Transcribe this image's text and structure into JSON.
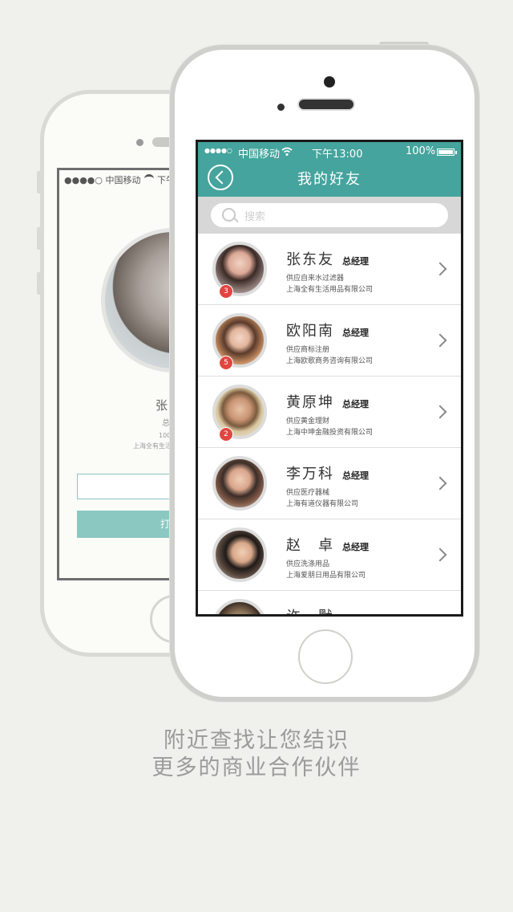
{
  "back_phone": {
    "carrier": "●●●●○ 中国移动",
    "time_partial": "下午",
    "name_partial": "张东",
    "title_partial": "总经",
    "count_partial": "100",
    "company_partial": "上海全有生活",
    "button_partial": "打"
  },
  "front_phone": {
    "status": {
      "signal": "●●●●○",
      "carrier": "中国移动",
      "time": "下午13:00",
      "battery": "100%"
    },
    "header": {
      "title": "我的好友"
    },
    "search": {
      "placeholder": "搜索"
    },
    "friends": [
      {
        "name": "张东友",
        "role": "总经理",
        "desc": "供应自来水过滤器",
        "company": "上海全有生活用品有限公司",
        "badge": "3"
      },
      {
        "name": "欧阳南",
        "role": "总经理",
        "desc": "供应商标注册",
        "company": "上海欧歌商务咨询有限公司",
        "badge": "5"
      },
      {
        "name": "黄原坤",
        "role": "总经理",
        "desc": "供应黄金理财",
        "company": "上海中坤金融投资有限公司",
        "badge": "2"
      },
      {
        "name": "李万科",
        "role": "总经理",
        "desc": "供应医疗器械",
        "company": "上海有道仪器有限公司",
        "badge": ""
      },
      {
        "name": "赵　卓",
        "role": "总经理",
        "desc": "供应洗涤用品",
        "company": "上海爱朋日用品有限公司",
        "badge": ""
      },
      {
        "name": "许　默",
        "role": "",
        "desc": "",
        "company": "",
        "badge": ""
      }
    ]
  },
  "caption": {
    "line1": "附近查找让您结识",
    "line2": "更多的商业合作伙伴"
  },
  "colors": {
    "accent": "#45a49d",
    "badge": "#e0463f",
    "background": "#f0f1ec"
  }
}
